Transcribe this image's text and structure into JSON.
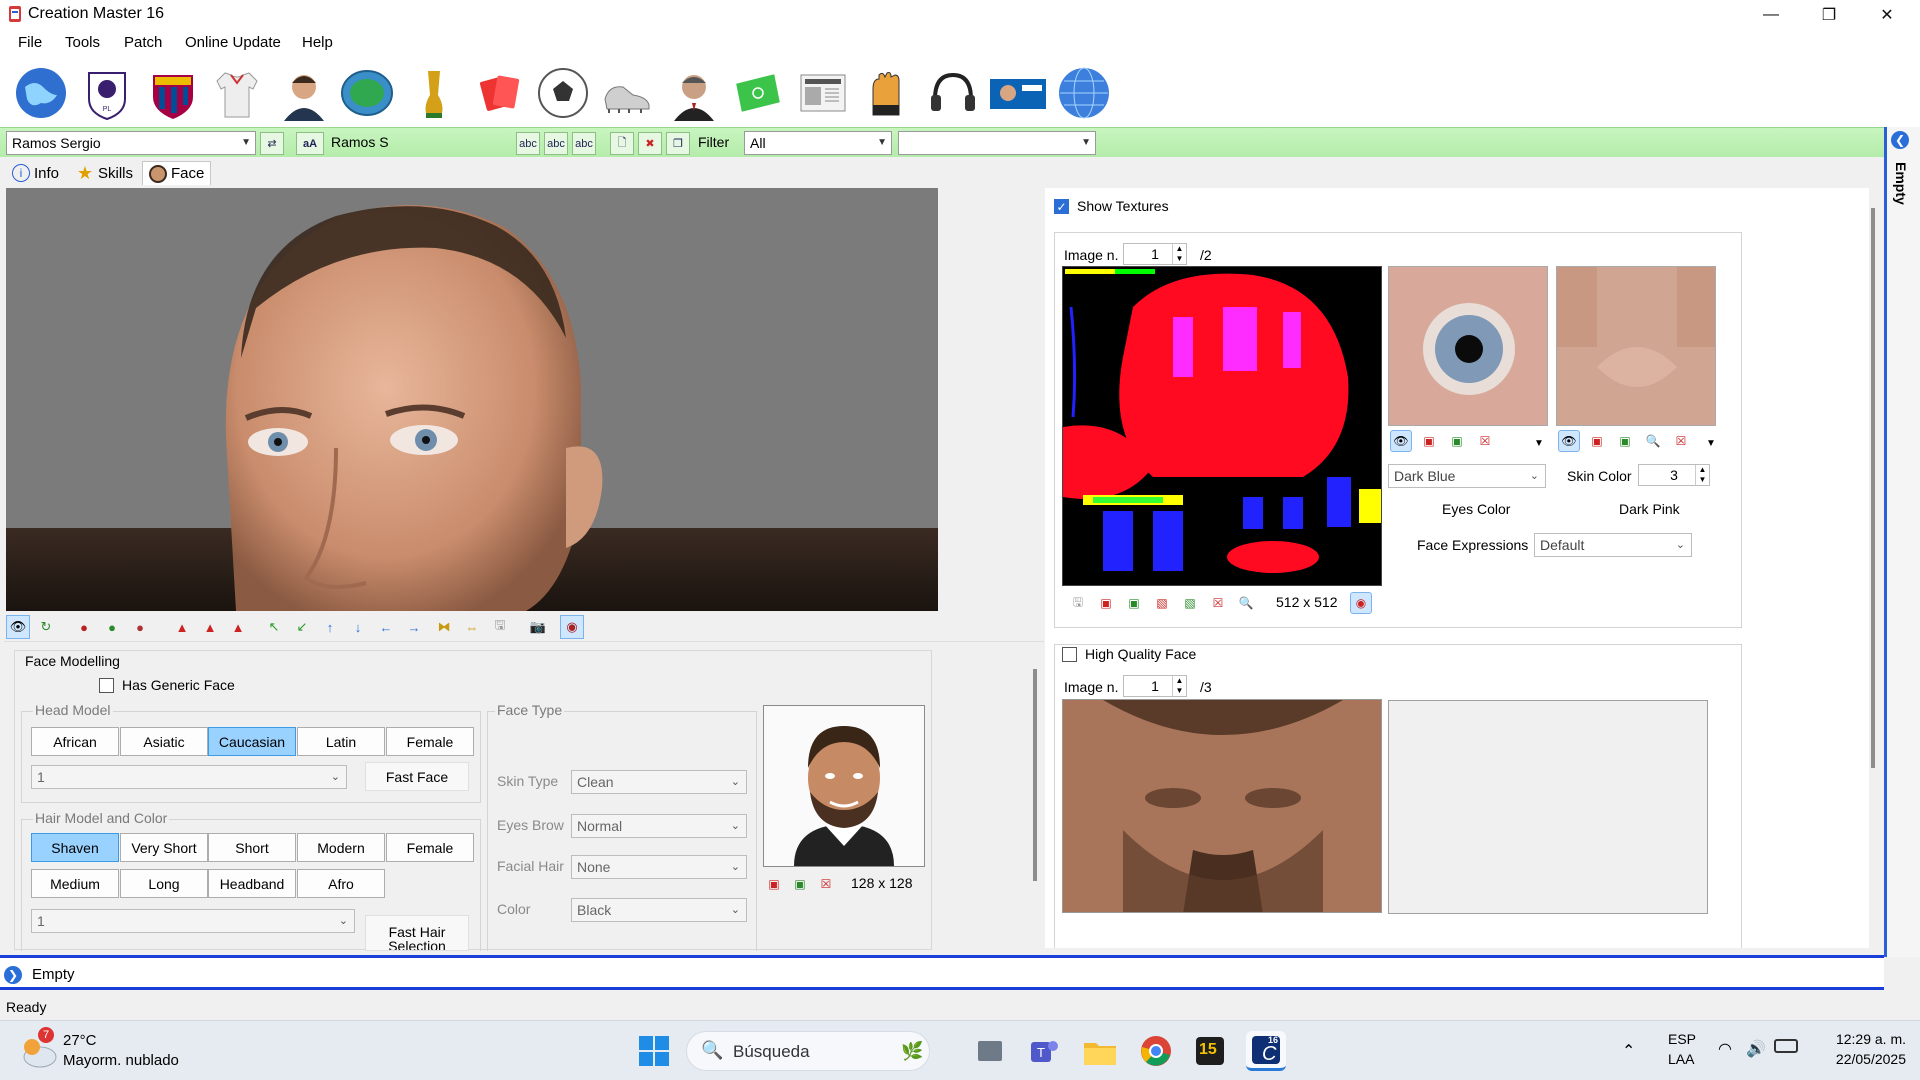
{
  "window": {
    "title": "Creation Master 16"
  },
  "menu": [
    "File",
    "Tools",
    "Patch",
    "Online Update",
    "Help"
  ],
  "toolbar_icons": [
    "world-globe-icon",
    "premier-league-icon",
    "fcb-badge-icon",
    "jersey-icon",
    "player-portrait-icon",
    "stadium-icon",
    "trophy-icon",
    "referee-card-icon",
    "ball-icon",
    "boots-icon",
    "manager-portrait-icon",
    "pitch-icon",
    "newspaper-icon",
    "goalkeeper-gloves-icon",
    "headphones-icon",
    "fifa-cover-icon",
    "update-globe-icon"
  ],
  "playerbar": {
    "player": "Ramos Sergio",
    "short_name": "Ramos S",
    "short_name_icon": "aA",
    "filter_label": "Filter",
    "filter_value": "All",
    "filter2_value": ""
  },
  "tabs": [
    "Info",
    "Skills",
    "Face"
  ],
  "dock_right_label": "Empty",
  "face_modelling": {
    "title": "Face Modelling",
    "has_generic_face": "Has Generic Face",
    "head_model_title": "Head Model",
    "head_models": [
      "African",
      "Asiatic",
      "Caucasian",
      "Latin",
      "Female"
    ],
    "head_selected": "Caucasian",
    "head_combo": "1",
    "fast_face": "Fast Face",
    "hair_title": "Hair Model and Color",
    "hair_models_row1": [
      "Shaven",
      "Very Short",
      "Short",
      "Modern",
      "Female"
    ],
    "hair_models_row2": [
      "Medium",
      "Long",
      "Headband",
      "Afro"
    ],
    "hair_selected": "Shaven",
    "hair_combo": "1",
    "fast_hair": "Fast Hair Selection"
  },
  "face_type": {
    "title": "Face Type",
    "skin_type_label": "Skin Type",
    "skin_type": "Clean",
    "eyebrow_label": "Eyes Brow",
    "eyebrow": "Normal",
    "facial_hair_label": "Facial Hair",
    "facial_hair": "None",
    "color_label": "Color",
    "color": "Black"
  },
  "photo": {
    "size": "128 x 128"
  },
  "textures": {
    "show_textures": "Show Textures",
    "image_label": "Image n.",
    "image_n": "1",
    "image_total": "/2",
    "size": "512 x 512",
    "eyes_color_value": "Dark Blue",
    "eyes_color_label": "Eyes Color",
    "skin_color_label": "Skin Color",
    "skin_color_value": "3",
    "skin_color_name": "Dark Pink",
    "face_expr_label": "Face Expressions",
    "face_expr_value": "Default"
  },
  "hq_face": {
    "label": "High Quality Face",
    "image_label": "Image n.",
    "image_n": "1",
    "image_total": "/3"
  },
  "bottom_dock": "Empty",
  "status": "Ready",
  "taskbar": {
    "weather_temp": "27°C",
    "weather_desc": "Mayorm. nublado",
    "weather_badge": "7",
    "search": "Búsqueda",
    "lang1": "ESP",
    "lang2": "LAA",
    "time": "12:29 a. m.",
    "date": "22/05/2025",
    "app_badge": "15",
    "cm_badge": "16"
  },
  "colors": {
    "green_bar": "#c8f5bf",
    "selected": "#99d1ff",
    "dock_blue": "#1a3fd8"
  }
}
